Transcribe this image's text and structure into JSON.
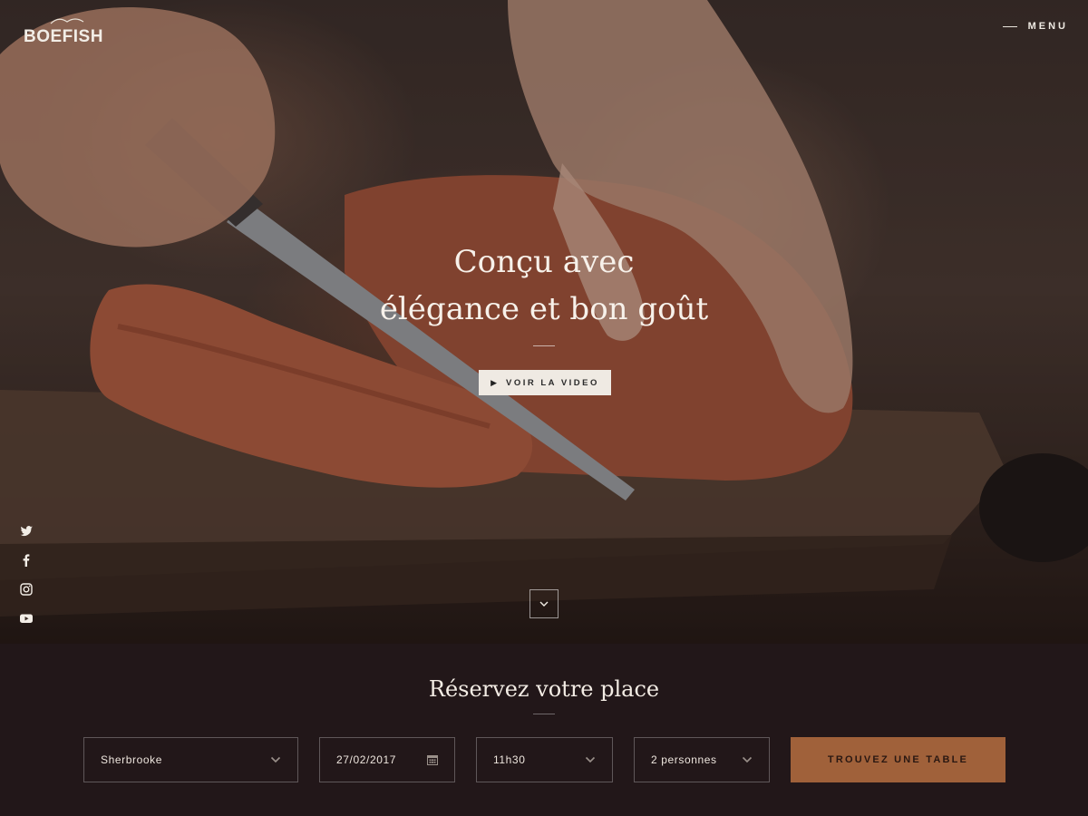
{
  "brand": {
    "name": "BOEFISH",
    "logo_icon": "bird-mark-icon"
  },
  "nav": {
    "menu_label": "MENU",
    "menu_icon": "menu-line-icon"
  },
  "hero": {
    "headline_line1": "Conçu avec",
    "headline_line2": "élégance et bon goût",
    "video_button_label": "VOIR LA VIDEO",
    "video_icon": "play-icon",
    "scroll_icon": "chevron-down-icon"
  },
  "socials": [
    {
      "name": "twitter-icon"
    },
    {
      "name": "facebook-icon"
    },
    {
      "name": "instagram-icon"
    },
    {
      "name": "youtube-icon"
    }
  ],
  "booking": {
    "title": "Réservez votre place",
    "location": "Sherbrooke",
    "date": "27/02/2017",
    "time": "11h30",
    "guests": "2 personnes",
    "submit_label": "TROUVEZ UNE TABLE"
  },
  "colors": {
    "background": "#221719",
    "accent": "#a0613a",
    "button_light": "#efeae3"
  }
}
